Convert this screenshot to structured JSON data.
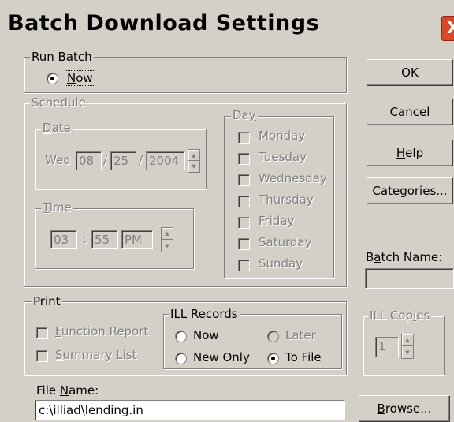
{
  "window": {
    "title": "Batch Download Settings",
    "close_glyph": "X"
  },
  "run_batch": {
    "legend_u": "R",
    "legend_rest": "un Batch",
    "now_label_u": "N",
    "now_label_rest": "ow",
    "now_selected": true
  },
  "schedule": {
    "legend": "Schedule",
    "date": {
      "legend_u": "D",
      "legend_rest": "ate",
      "weekday": "Wed",
      "month": "08",
      "sep1": "/",
      "day": "25",
      "sep2": "/",
      "year": "2004"
    },
    "time": {
      "legend_u": "T",
      "legend_rest": "ime",
      "hour": "03",
      "sep": ":",
      "minute": "55",
      "ampm": "PM"
    },
    "day": {
      "legend_pre": "Da",
      "legend_u": "y",
      "items": [
        "Monday",
        "Tuesday",
        "Wednesday",
        "Thursday",
        "Friday",
        "Saturday",
        "Sunday"
      ]
    }
  },
  "buttons": {
    "ok": "OK",
    "cancel": "Cancel",
    "help_u": "H",
    "help_rest": "elp",
    "categories_u": "C",
    "categories_rest": "ategories...",
    "browse_u": "B",
    "browse_rest": "rowse..."
  },
  "batch_name": {
    "label_pre": "B",
    "label_u": "a",
    "label_rest": "tch Name:",
    "value": ""
  },
  "print": {
    "legend": "Print",
    "function_report_u": "F",
    "function_report_rest": "unction Report",
    "summary_list_u": "S",
    "summary_list_rest": "ummary List"
  },
  "ill_records": {
    "legend_u": "I",
    "legend_rest": "LL Records",
    "now": "Now",
    "later": "Later",
    "new_only": "New Only",
    "to_file": "To File",
    "selected": "To File"
  },
  "ill_copies": {
    "legend_pre": "ILL Cop",
    "legend_u": "i",
    "legend_rest": "es",
    "value": "1"
  },
  "file_name": {
    "label_pre": "File ",
    "label_u": "N",
    "label_rest": "ame:",
    "value": "c:\\illiad\\lending.in"
  }
}
